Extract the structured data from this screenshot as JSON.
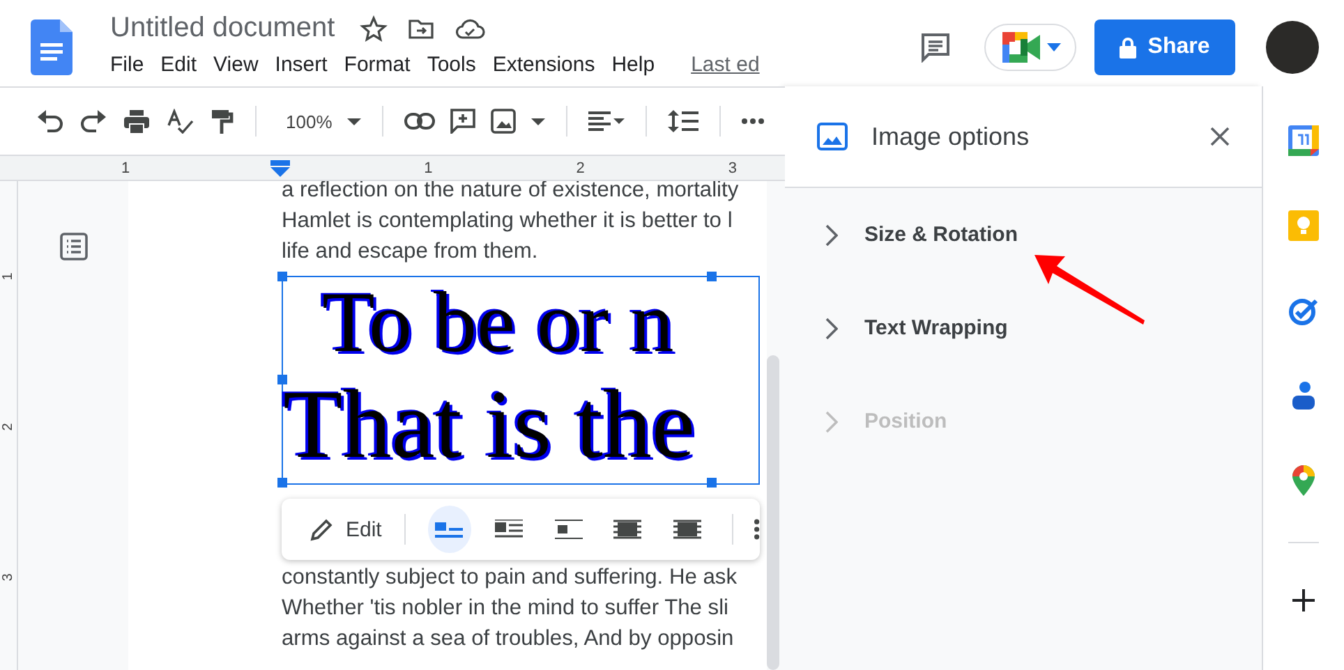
{
  "header": {
    "title": "Untitled document",
    "menu": [
      "File",
      "Edit",
      "View",
      "Insert",
      "Format",
      "Tools",
      "Extensions",
      "Help"
    ],
    "last_edit": "Last ed",
    "share_label": "Share"
  },
  "toolbar": {
    "zoom": "100%"
  },
  "ruler": {
    "labels": [
      "1",
      "1",
      "2",
      "3"
    ],
    "vertical_labels": [
      "1",
      "2",
      "3"
    ]
  },
  "document": {
    "lines_before": [
      "a reflection on the nature of existence, mortality",
      "Hamlet is contemplating whether it is better to l",
      "life and escape from them."
    ],
    "image_lines": [
      "To be or n",
      "That is the"
    ],
    "lines_after": [
      "constantly subject to pain and suffering. He ask",
      "Whether 'tis nobler in the mind to suffer The sli",
      "arms against a sea of troubles, And by opposin"
    ]
  },
  "image_toolbar": {
    "edit_label": "Edit",
    "wrap_options": [
      {
        "kind": "inline",
        "selected": true
      },
      {
        "kind": "wrap",
        "selected": false
      },
      {
        "kind": "break",
        "selected": false
      },
      {
        "kind": "behind",
        "selected": false
      },
      {
        "kind": "front",
        "selected": false
      }
    ]
  },
  "panel": {
    "title": "Image options",
    "sections": [
      {
        "label": "Size & Rotation",
        "disabled": false
      },
      {
        "label": "Text Wrapping",
        "disabled": false
      },
      {
        "label": "Position",
        "disabled": true
      }
    ]
  }
}
